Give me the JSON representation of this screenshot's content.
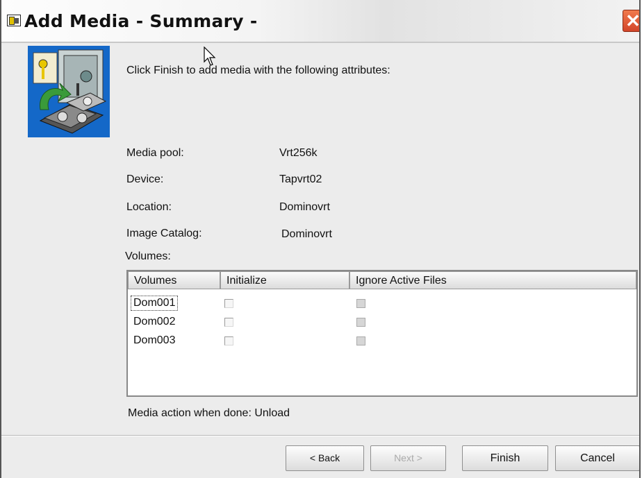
{
  "window": {
    "title": "Add Media - Summary -",
    "close_glyph": "✕"
  },
  "intro_text": "Click Finish to add media with the following attributes:",
  "attributes": [
    {
      "label": "Media pool:",
      "value": "Vrt256k"
    },
    {
      "label": "Device:",
      "value": "Tapvrt02"
    },
    {
      "label": "Location:",
      "value": "Dominovrt"
    },
    {
      "label": "Image Catalog:",
      "value": "Dominovrt"
    }
  ],
  "volumes_heading": "Volumes:",
  "table": {
    "columns": [
      "Volumes",
      "Initialize",
      "Ignore Active Files"
    ],
    "rows": [
      {
        "name": "Dom001",
        "initialize": false,
        "ignore_active_files": false
      },
      {
        "name": "Dom002",
        "initialize": false,
        "ignore_active_files": false
      },
      {
        "name": "Dom003",
        "initialize": false,
        "ignore_active_files": false
      }
    ]
  },
  "action_text": "Media action when done:  Unload",
  "buttons": {
    "back": "< Back",
    "next": "Next >",
    "finish": "Finish",
    "cancel": "Cancel"
  },
  "icons": [
    "window-icon",
    "close-icon",
    "wizard-media-safe-icon",
    "mouse-pointer-icon"
  ]
}
